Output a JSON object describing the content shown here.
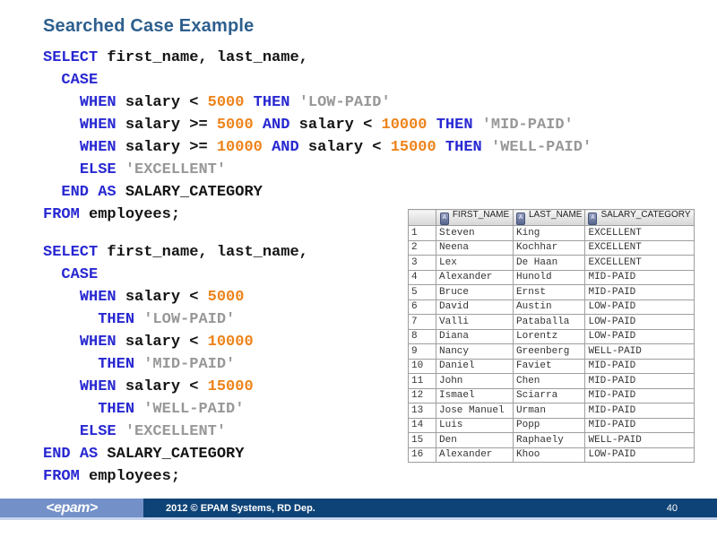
{
  "title": "Searched Case Example",
  "colors": {
    "title": "#2D5F8D",
    "sql_keyword": "#2828D2",
    "sql_number": "#ED831A",
    "sql_string": "#989898",
    "sql_plain": "#141414",
    "footer_light_blue": "#7390C9",
    "footer_dark_blue": "#0E4377",
    "footer_underline": "#C7D5EC",
    "table_border": "#9E9E9E"
  },
  "code_blocks": [
    {
      "name": "searched-case-inline-query",
      "lines": [
        [
          {
            "t": "SELECT",
            "c": "kw"
          },
          {
            "t": " first_name, last_name,",
            "c": "pl"
          }
        ],
        [
          {
            "t": "  ",
            "c": "pl"
          },
          {
            "t": "CASE",
            "c": "kw"
          }
        ],
        [
          {
            "t": "    ",
            "c": "pl"
          },
          {
            "t": "WHEN",
            "c": "kw"
          },
          {
            "t": " salary < ",
            "c": "pl"
          },
          {
            "t": "5000",
            "c": "num"
          },
          {
            "t": " ",
            "c": "pl"
          },
          {
            "t": "THEN",
            "c": "kw"
          },
          {
            "t": " ",
            "c": "pl"
          },
          {
            "t": "'LOW-PAID'",
            "c": "str"
          }
        ],
        [
          {
            "t": "    ",
            "c": "pl"
          },
          {
            "t": "WHEN",
            "c": "kw"
          },
          {
            "t": " salary >= ",
            "c": "pl"
          },
          {
            "t": "5000",
            "c": "num"
          },
          {
            "t": " ",
            "c": "pl"
          },
          {
            "t": "AND",
            "c": "kw"
          },
          {
            "t": " salary < ",
            "c": "pl"
          },
          {
            "t": "10000",
            "c": "num"
          },
          {
            "t": " ",
            "c": "pl"
          },
          {
            "t": "THEN",
            "c": "kw"
          },
          {
            "t": " ",
            "c": "pl"
          },
          {
            "t": "'MID-PAID'",
            "c": "str"
          }
        ],
        [
          {
            "t": "    ",
            "c": "pl"
          },
          {
            "t": "WHEN",
            "c": "kw"
          },
          {
            "t": " salary >= ",
            "c": "pl"
          },
          {
            "t": "10000",
            "c": "num"
          },
          {
            "t": " ",
            "c": "pl"
          },
          {
            "t": "AND",
            "c": "kw"
          },
          {
            "t": " salary < ",
            "c": "pl"
          },
          {
            "t": "15000",
            "c": "num"
          },
          {
            "t": " ",
            "c": "pl"
          },
          {
            "t": "THEN",
            "c": "kw"
          },
          {
            "t": " ",
            "c": "pl"
          },
          {
            "t": "'WELL-PAID'",
            "c": "str"
          }
        ],
        [
          {
            "t": "    ",
            "c": "pl"
          },
          {
            "t": "ELSE",
            "c": "kw"
          },
          {
            "t": " ",
            "c": "pl"
          },
          {
            "t": "'EXCELLENT'",
            "c": "str"
          }
        ],
        [
          {
            "t": "  ",
            "c": "pl"
          },
          {
            "t": "END",
            "c": "kw"
          },
          {
            "t": " ",
            "c": "pl"
          },
          {
            "t": "AS",
            "c": "kw"
          },
          {
            "t": " SALARY_CATEGORY",
            "c": "pl"
          }
        ],
        [
          {
            "t": "FROM",
            "c": "kw"
          },
          {
            "t": " employees;",
            "c": "pl"
          }
        ]
      ]
    },
    {
      "name": "searched-case-expanded-query",
      "lines": [
        [
          {
            "t": "SELECT",
            "c": "kw"
          },
          {
            "t": " first_name, last_name,",
            "c": "pl"
          }
        ],
        [
          {
            "t": "  ",
            "c": "pl"
          },
          {
            "t": "CASE",
            "c": "kw"
          }
        ],
        [
          {
            "t": "    ",
            "c": "pl"
          },
          {
            "t": "WHEN",
            "c": "kw"
          },
          {
            "t": " salary < ",
            "c": "pl"
          },
          {
            "t": "5000",
            "c": "num"
          }
        ],
        [
          {
            "t": "      ",
            "c": "pl"
          },
          {
            "t": "THEN",
            "c": "kw"
          },
          {
            "t": " ",
            "c": "pl"
          },
          {
            "t": "'LOW-PAID'",
            "c": "str"
          }
        ],
        [
          {
            "t": "    ",
            "c": "pl"
          },
          {
            "t": "WHEN",
            "c": "kw"
          },
          {
            "t": " salary < ",
            "c": "pl"
          },
          {
            "t": "10000",
            "c": "num"
          }
        ],
        [
          {
            "t": "      ",
            "c": "pl"
          },
          {
            "t": "THEN",
            "c": "kw"
          },
          {
            "t": " ",
            "c": "pl"
          },
          {
            "t": "'MID-PAID'",
            "c": "str"
          }
        ],
        [
          {
            "t": "    ",
            "c": "pl"
          },
          {
            "t": "WHEN",
            "c": "kw"
          },
          {
            "t": " salary < ",
            "c": "pl"
          },
          {
            "t": "15000",
            "c": "num"
          }
        ],
        [
          {
            "t": "      ",
            "c": "pl"
          },
          {
            "t": "THEN",
            "c": "kw"
          },
          {
            "t": " ",
            "c": "pl"
          },
          {
            "t": "'WELL-PAID'",
            "c": "str"
          }
        ],
        [
          {
            "t": "    ",
            "c": "pl"
          },
          {
            "t": "ELSE",
            "c": "kw"
          },
          {
            "t": " ",
            "c": "pl"
          },
          {
            "t": "'EXCELLENT'",
            "c": "str"
          }
        ],
        [
          {
            "t": "END",
            "c": "kw"
          },
          {
            "t": " ",
            "c": "pl"
          },
          {
            "t": "AS",
            "c": "kw"
          },
          {
            "t": " SALARY_CATEGORY",
            "c": "pl"
          }
        ],
        [
          {
            "t": "FROM",
            "c": "kw"
          },
          {
            "t": " employees;",
            "c": "pl"
          }
        ]
      ]
    }
  ],
  "result_table": {
    "column_icon_glyph": "A",
    "columns": [
      "FIRST_NAME",
      "LAST_NAME",
      "SALARY_CATEGORY"
    ],
    "rows": [
      [
        "1",
        "Steven",
        "King",
        "EXCELLENT"
      ],
      [
        "2",
        "Neena",
        "Kochhar",
        "EXCELLENT"
      ],
      [
        "3",
        "Lex",
        "De Haan",
        "EXCELLENT"
      ],
      [
        "4",
        "Alexander",
        "Hunold",
        "MID-PAID"
      ],
      [
        "5",
        "Bruce",
        "Ernst",
        "MID-PAID"
      ],
      [
        "6",
        "David",
        "Austin",
        "LOW-PAID"
      ],
      [
        "7",
        "Valli",
        "Pataballa",
        "LOW-PAID"
      ],
      [
        "8",
        "Diana",
        "Lorentz",
        "LOW-PAID"
      ],
      [
        "9",
        "Nancy",
        "Greenberg",
        "WELL-PAID"
      ],
      [
        "10",
        "Daniel",
        "Faviet",
        "MID-PAID"
      ],
      [
        "11",
        "John",
        "Chen",
        "MID-PAID"
      ],
      [
        "12",
        "Ismael",
        "Sciarra",
        "MID-PAID"
      ],
      [
        "13",
        "Jose Manuel",
        "Urman",
        "MID-PAID"
      ],
      [
        "14",
        "Luis",
        "Popp",
        "MID-PAID"
      ],
      [
        "15",
        "Den",
        "Raphaely",
        "WELL-PAID"
      ],
      [
        "16",
        "Alexander",
        "Khoo",
        "LOW-PAID"
      ]
    ]
  },
  "footer": {
    "logo": "<epam>",
    "copyright": "2012 © EPAM Systems, RD Dep.",
    "page_number": "40"
  }
}
